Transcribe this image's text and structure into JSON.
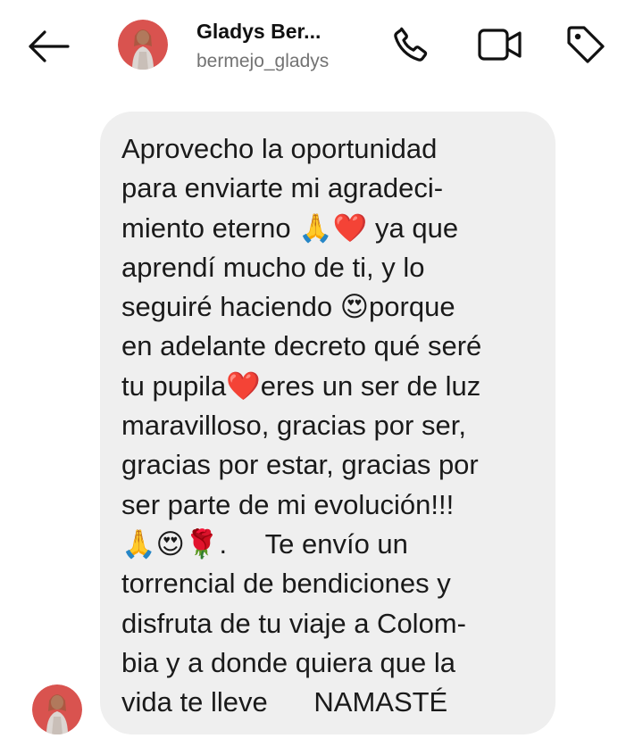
{
  "header": {
    "contact_name": "Gladys Ber...",
    "username": "bermejo_gladys"
  },
  "icons": {
    "back": "arrow-left-icon",
    "call": "phone-icon",
    "video": "video-camera-icon",
    "tag": "tag-icon"
  },
  "message": {
    "text": "Aprovecho la oportunidad\npara enviarte mi agradeci-\nmiento eterno 🙏❤️ ya que\naprendí mucho de ti, y lo\nseguiré haciendo 😍porque\nen adelante decreto qué seré\ntu pupila❤️eres un ser de luz\nmaravilloso, gracias por ser,\ngracias por estar, gracias por\nser parte de mi evolución!!!\n🙏😍🌹.     Te envío un\ntorrencial de bendiciones y\ndisfruta de tu viaje a Colom-\nbia y a donde quiera que la\nvida te lleve      NAMASTÉ"
  },
  "colors": {
    "bubble_bg": "#efefef",
    "secondary_text": "#737373",
    "avatar_bg": "#d9534f"
  }
}
